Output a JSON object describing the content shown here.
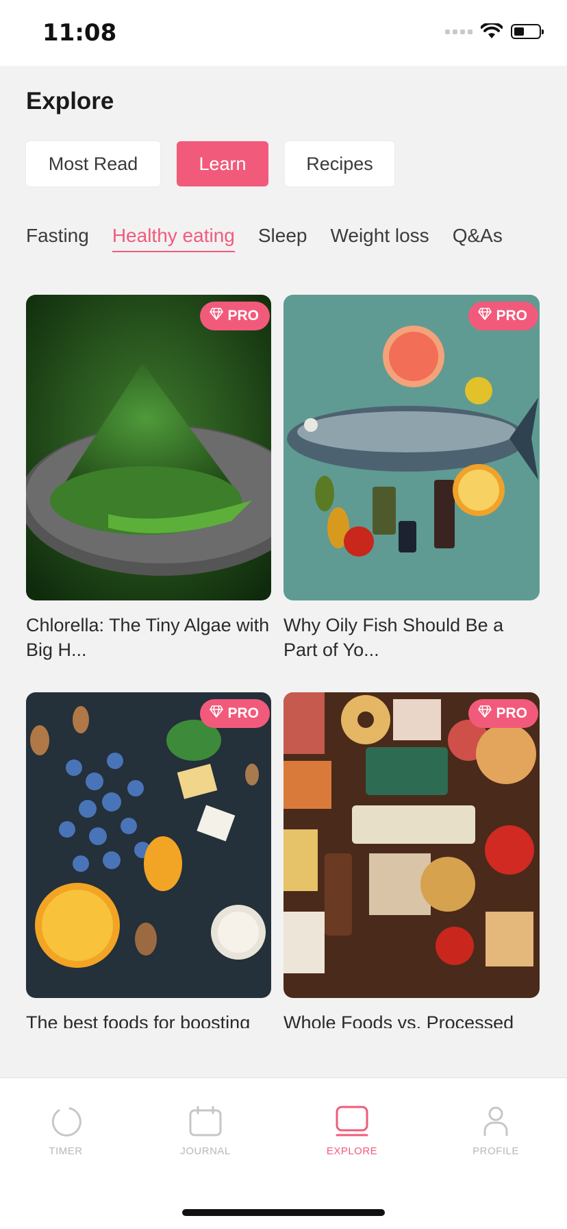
{
  "status_bar": {
    "time": "11:08"
  },
  "header": {
    "title": "Explore"
  },
  "segments": [
    {
      "label": "Most Read",
      "active": false
    },
    {
      "label": "Learn",
      "active": true
    },
    {
      "label": "Recipes",
      "active": false
    }
  ],
  "categories": [
    {
      "label": "Fasting",
      "active": false
    },
    {
      "label": "Healthy eating",
      "active": true
    },
    {
      "label": "Sleep",
      "active": false
    },
    {
      "label": "Weight loss",
      "active": false
    },
    {
      "label": "Q&As",
      "active": false
    }
  ],
  "articles": [
    {
      "title": "Chlorella: The Tiny Algae with Big H...",
      "badge": "PRO"
    },
    {
      "title": "Why Oily Fish Should Be a Part of Yo...",
      "badge": "PRO"
    },
    {
      "title": "The best foods for boosting",
      "badge": "PRO"
    },
    {
      "title": "Whole Foods vs. Processed",
      "badge": "PRO"
    }
  ],
  "bottom_nav": [
    {
      "label": "TIMER",
      "icon": "circle-icon",
      "active": false
    },
    {
      "label": "JOURNAL",
      "icon": "calendar-icon",
      "active": false
    },
    {
      "label": "EXPLORE",
      "icon": "explore-icon",
      "active": true
    },
    {
      "label": "PROFILE",
      "icon": "person-icon",
      "active": false
    }
  ],
  "colors": {
    "accent": "#f25a7b",
    "background": "#f2f2f2"
  }
}
